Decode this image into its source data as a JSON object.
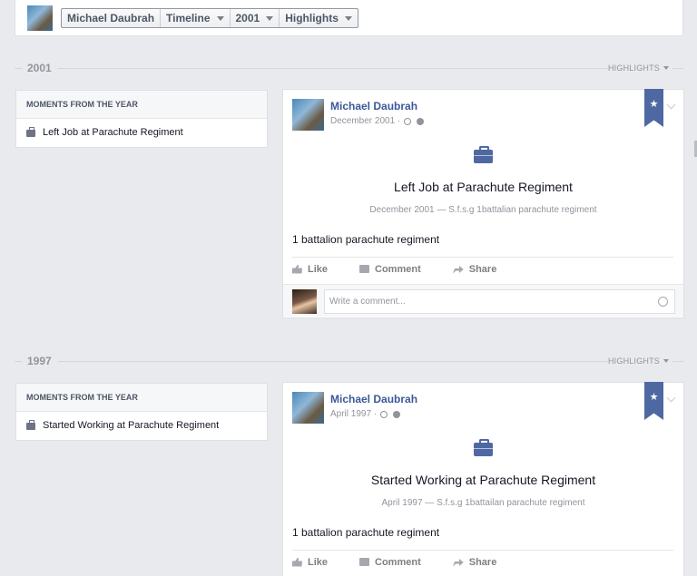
{
  "topbar": {
    "name": "Michael Daubrah",
    "timeline": "Timeline",
    "year": "2001",
    "filter": "Highlights"
  },
  "sections": [
    {
      "year": "2001",
      "highlights": "HIGHLIGHTS",
      "moments_header": "MOMENTS FROM THE YEAR",
      "moment_item": "Left Job at Parachute Regiment",
      "story": {
        "author": "Michael Daubrah",
        "date": "December 2001 ·",
        "ribbon": "★",
        "event_title": "Left Job at Parachute Regiment",
        "event_sub": "December 2001 — S.f.s.g 1battalian parachute regiment",
        "text": "1 battalion parachute regiment",
        "like": "Like",
        "comment": "Comment",
        "share": "Share",
        "comment_placeholder": "Write a comment..."
      }
    },
    {
      "year": "1997",
      "highlights": "HIGHLIGHTS",
      "moments_header": "MOMENTS FROM THE YEAR",
      "moment_item": "Started Working at Parachute Regiment",
      "story": {
        "author": "Michael Daubrah",
        "date": "April 1997 ·",
        "ribbon": "★",
        "event_title": "Started Working at Parachute Regiment",
        "event_sub": "April 1997 — S.f.s.g 1battailan parachute regiment",
        "text": "1 battalion parachute regiment",
        "like": "Like",
        "comment": "Comment",
        "share": "Share"
      }
    }
  ],
  "icons": {
    "accent": "#3b5998",
    "ribbon": "#4e69a2"
  }
}
